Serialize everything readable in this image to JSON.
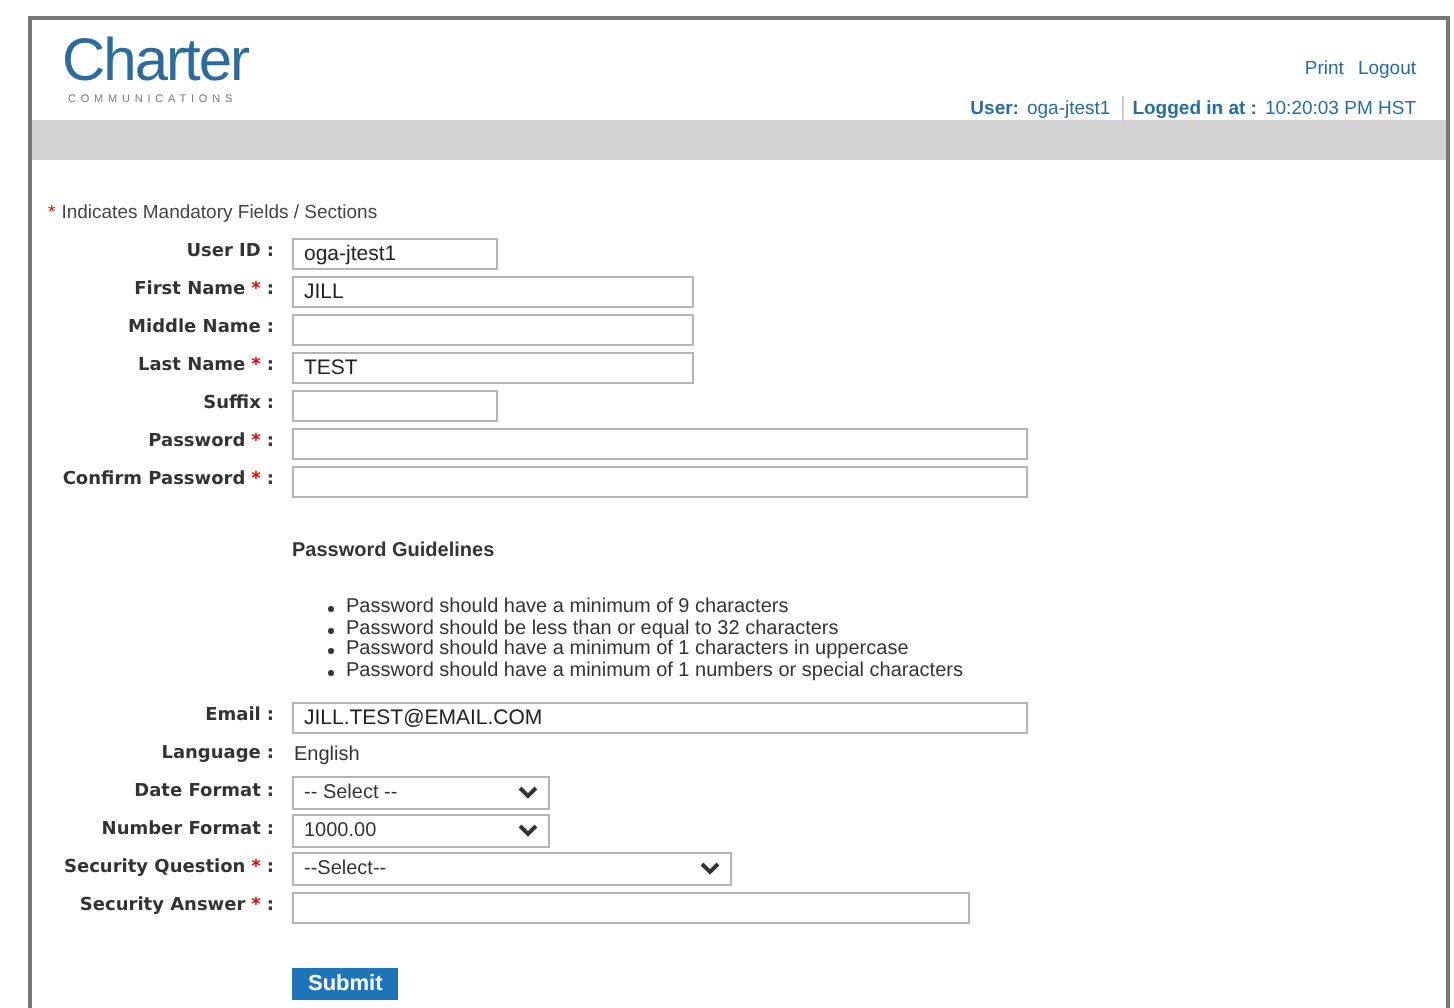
{
  "header": {
    "logo": {
      "name": "Charter",
      "tagline": "COMMUNICATIONS"
    },
    "links": [
      "Print",
      "Logout"
    ],
    "user_label": "User:",
    "user_value": "oga-jtest1",
    "login_label": "Logged in at :",
    "login_value": "10:20:03 PM HST"
  },
  "form": {
    "mandatory_note": {
      "mark": "*",
      "text": "Indicates Mandatory Fields / Sections"
    },
    "fields_top": [
      {
        "kind": "short_text",
        "label": "User ID",
        "colon": ":",
        "required": false,
        "value": "oga-jtest1"
      },
      {
        "kind": "text",
        "label": "First Name",
        "colon": ":",
        "required": true,
        "value": "JILL"
      },
      {
        "kind": "text",
        "label": "Middle Name",
        "colon": ":",
        "required": false
      },
      {
        "kind": "text",
        "label": "Last Name",
        "colon": ":",
        "required": true,
        "value": "TEST"
      },
      {
        "kind": "short_text",
        "label": "Suffix",
        "colon": ":",
        "required": false
      },
      {
        "kind": "long_text",
        "label": "Password",
        "colon": ":",
        "required": true
      },
      {
        "kind": "long_text",
        "label": "Confirm Password",
        "colon": ":",
        "required": true
      }
    ],
    "guidelines": {
      "title": "Password Guidelines",
      "items": [
        "Password should have a minimum of 9 characters",
        "Password should be less than or equal to 32 characters",
        "Password should have a minimum of 1 characters in uppercase",
        "Password should have a minimum of 1 numbers or special characters"
      ]
    },
    "fields_bottom": [
      {
        "kind": "long_text",
        "label": "Email",
        "colon": ":",
        "required": false,
        "value": "JILL.TEST@EMAIL.COM"
      },
      {
        "kind": "static",
        "label": "Language",
        "colon": ":",
        "required": false,
        "value": "English"
      },
      {
        "kind": "short_select",
        "label": "Date Format",
        "colon": ":",
        "required": false,
        "value": "-- Select --"
      },
      {
        "kind": "short_select",
        "label": "Number Format",
        "colon": ":",
        "required": false,
        "value": "1000.00"
      },
      {
        "kind": "select",
        "label": "Security Question",
        "colon": ":",
        "required": true,
        "value": "--Select--"
      },
      {
        "kind": "wide_text",
        "label": "Security Answer",
        "colon": ":",
        "required": true
      }
    ],
    "submit": "Submit"
  }
}
